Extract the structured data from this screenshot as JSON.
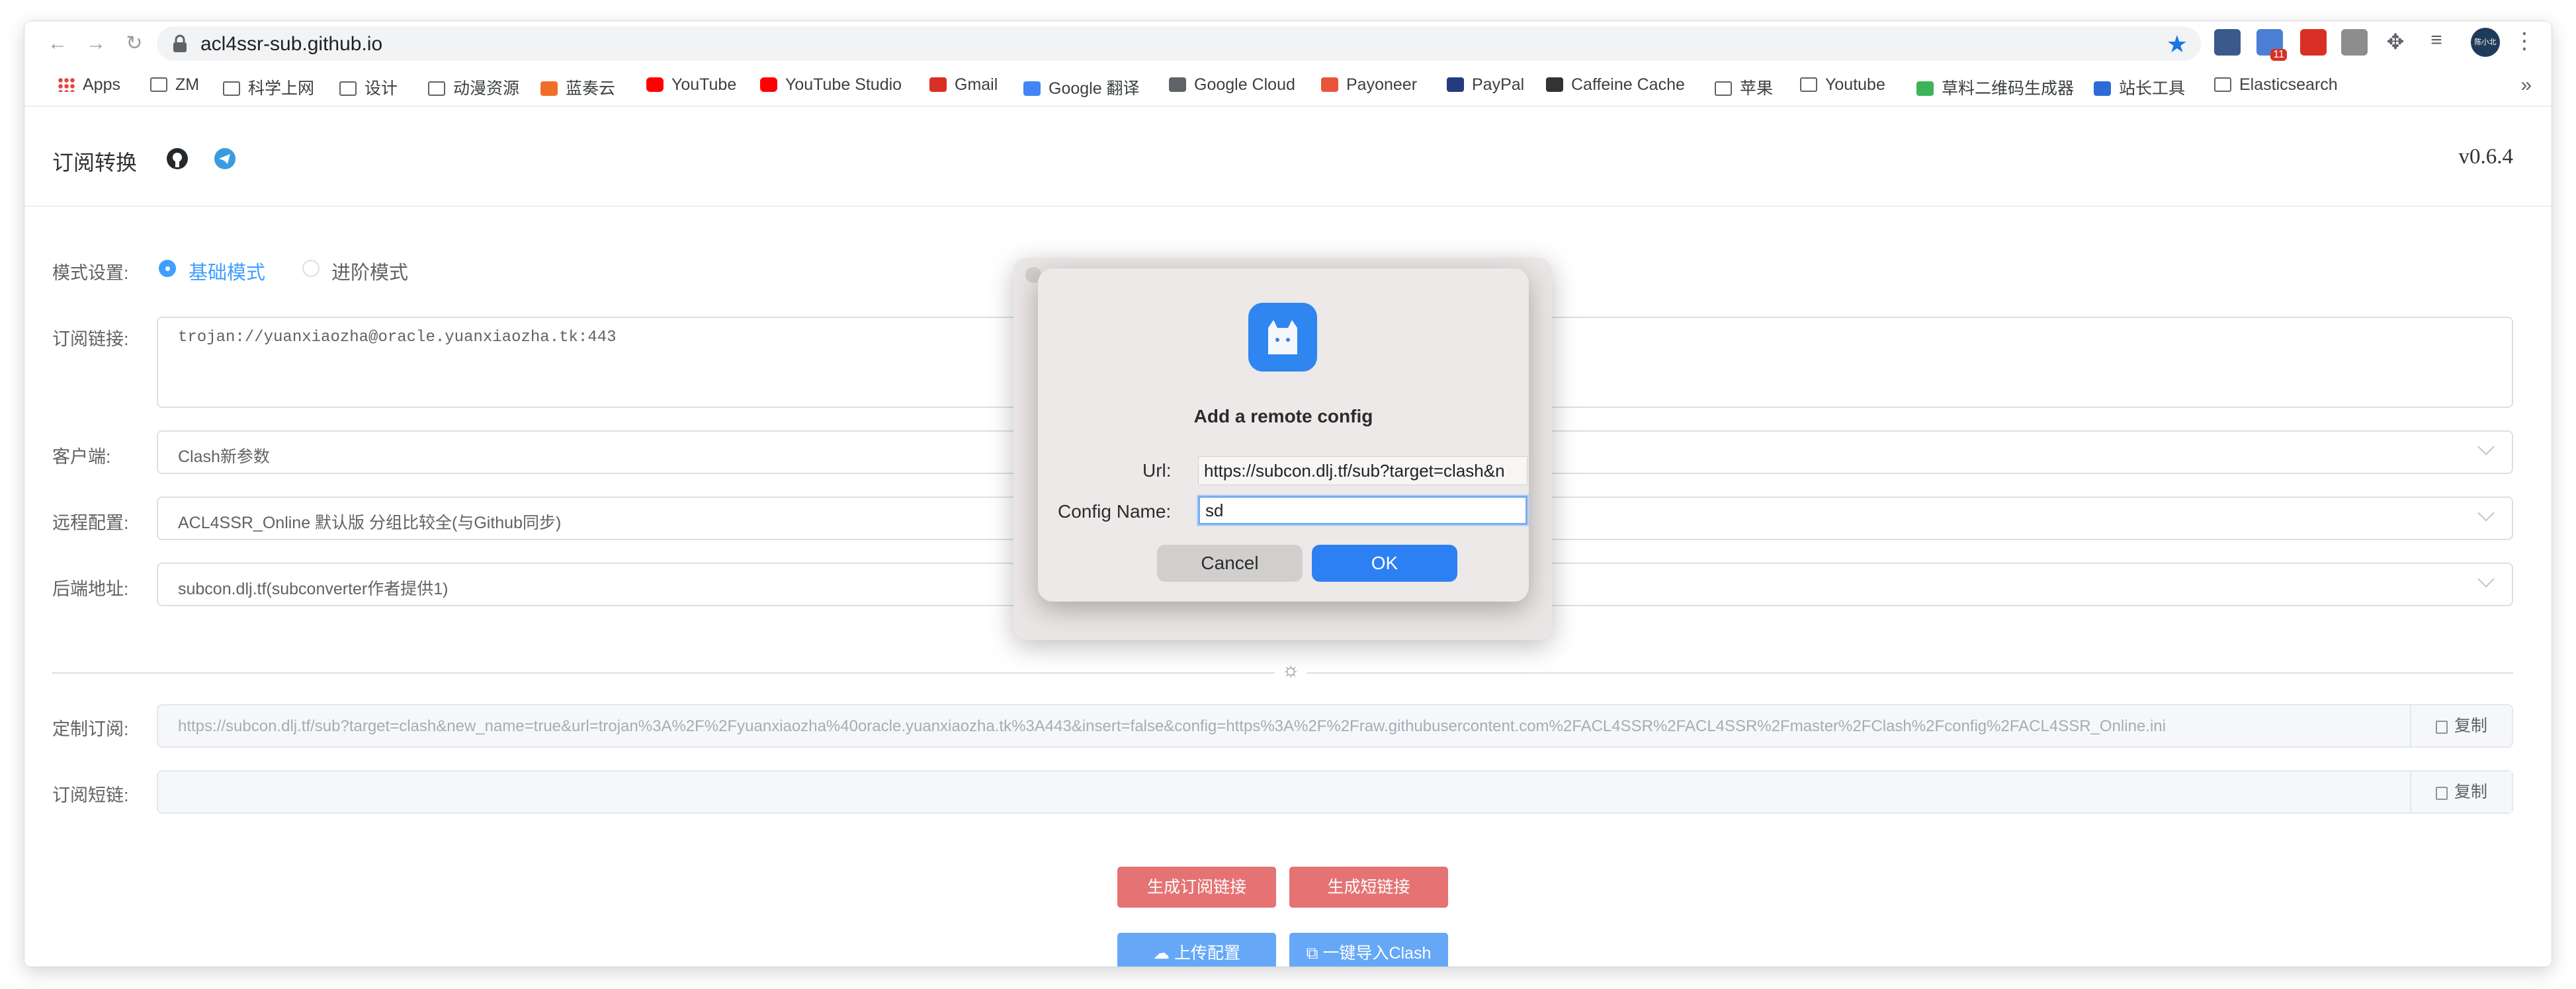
{
  "browser": {
    "url": "acl4ssr-sub.github.io",
    "ext_badge": "11",
    "profile_label": "陈小北",
    "bookmarks": [
      {
        "label": "Apps",
        "icon": "apps-grid-icon"
      },
      {
        "label": "ZM",
        "icon": "folder-icon"
      },
      {
        "label": "科学上网",
        "icon": "folder-icon"
      },
      {
        "label": "设计",
        "icon": "folder-icon"
      },
      {
        "label": "动漫资源",
        "icon": "folder-icon"
      },
      {
        "label": "蓝奏云",
        "icon": "lanzou-icon"
      },
      {
        "label": "YouTube",
        "icon": "youtube-icon"
      },
      {
        "label": "YouTube Studio",
        "icon": "youtube-icon"
      },
      {
        "label": "Gmail",
        "icon": "gmail-icon"
      },
      {
        "label": "Google 翻译",
        "icon": "google-translate-icon"
      },
      {
        "label": "Google Cloud",
        "icon": "google-cloud-icon"
      },
      {
        "label": "Payoneer",
        "icon": "payoneer-icon"
      },
      {
        "label": "PayPal",
        "icon": "paypal-icon"
      },
      {
        "label": "Caffeine Cache",
        "icon": "caffeine-icon"
      },
      {
        "label": "苹果",
        "icon": "folder-icon"
      },
      {
        "label": "Youtube",
        "icon": "folder-icon"
      },
      {
        "label": "草料二维码生成器",
        "icon": "qr-icon"
      },
      {
        "label": "站长工具",
        "icon": "webmaster-icon"
      },
      {
        "label": "Elasticsearch",
        "icon": "folder-icon"
      }
    ],
    "more": "»"
  },
  "page": {
    "brand": "订阅转换",
    "version": "v0.6.4",
    "mode_label": "模式设置:",
    "mode_basic": "基础模式",
    "mode_advanced": "进阶模式",
    "sub_link_label": "订阅链接:",
    "sub_link_value": "trojan://yuanxiaozha@oracle.yuanxiaozha.tk:443",
    "client_label": "客户端:",
    "client_value": "Clash新参数",
    "remote_label": "远程配置:",
    "remote_value": "ACL4SSR_Online 默认版 分组比较全(与Github同步)",
    "backend_label": "后端地址:",
    "backend_value": "subcon.dlj.tf(subconverter作者提供1)",
    "custom_sub_label": "定制订阅:",
    "custom_sub_value": "https://subcon.dlj.tf/sub?target=clash&new_name=true&url=trojan%3A%2F%2Fyuanxiaozha%40oracle.yuanxiaozha.tk%3A443&insert=false&config=https%3A%2F%2Fraw.githubusercontent.com%2FACL4SSR%2FACL4SSR%2Fmaster%2FClash%2Fconfig%2FACL4SSR_Online.ini",
    "short_link_label": "订阅短链:",
    "short_link_value": "",
    "copy_label": "复制",
    "gen_sub_button": "生成订阅链接",
    "gen_short_button": "生成短链接",
    "upload_button": "上传配置",
    "import_clash_button": "一键导入Clash"
  },
  "dialog": {
    "title": "Add a remote config",
    "url_label": "Url:",
    "url_value": "https://subcon.dlj.tf/sub?target=clash&n",
    "name_label": "Config Name:",
    "name_value": "sd",
    "cancel": "Cancel",
    "ok": "OK"
  },
  "colors": {
    "primary": "#409eff",
    "danger_button": "#e57373",
    "upload_button": "#66a8f7",
    "dialog_ok": "#2d80f3"
  }
}
